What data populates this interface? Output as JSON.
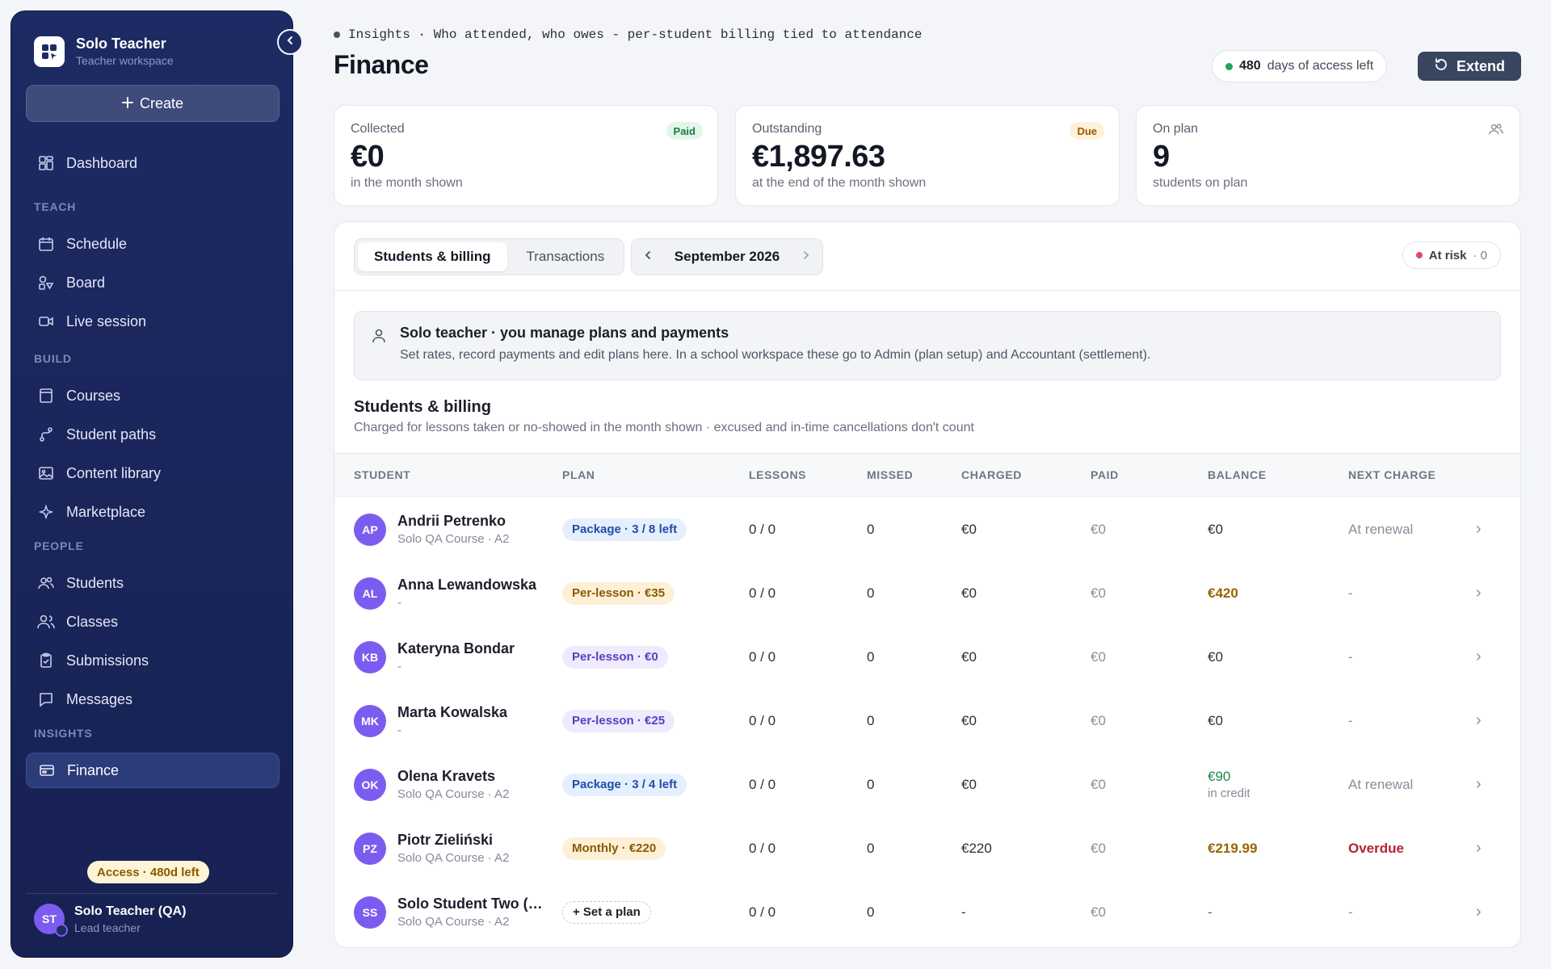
{
  "sidebar": {
    "brand_title": "Solo Teacher",
    "brand_sub": "Teacher workspace",
    "create_label": "Create",
    "dashboard": "Dashboard",
    "sections": {
      "teach": "TEACH",
      "build": "BUILD",
      "people": "PEOPLE",
      "insights": "INSIGHTS"
    },
    "items": {
      "schedule": "Schedule",
      "board": "Board",
      "live": "Live session",
      "courses": "Courses",
      "paths": "Student paths",
      "library": "Content library",
      "marketplace": "Marketplace",
      "students": "Students",
      "classes": "Classes",
      "submissions": "Submissions",
      "messages": "Messages",
      "finance": "Finance"
    },
    "access_pill": "Access · 480d left",
    "user_initials": "ST",
    "user_name": "Solo Teacher (QA)",
    "user_role": "Lead teacher"
  },
  "header": {
    "crumb": "Insights · Who attended, who owes - per-student billing tied to attendance",
    "title": "Finance",
    "days_count": "480",
    "days_label": "days of access left",
    "extend_label": "Extend"
  },
  "stats": {
    "collected": {
      "label": "Collected",
      "value": "€0",
      "note": "in the month shown",
      "badge": "Paid"
    },
    "outstanding": {
      "label": "Outstanding",
      "value": "€1,897.63",
      "note": "at the end of the month shown",
      "badge": "Due"
    },
    "on_plan": {
      "label": "On plan",
      "value": "9",
      "note": "students on plan"
    }
  },
  "panel": {
    "tab_students": "Students & billing",
    "tab_transactions": "Transactions",
    "month": "September 2026",
    "risk_label": "At risk",
    "risk_count": "· 0",
    "info_title": "Solo teacher · you manage plans and payments",
    "info_text": "Set rates, record payments and edit plans here. In a school workspace these go to Admin (plan setup) and Accountant (settlement).",
    "section_title": "Students & billing",
    "section_sub": "Charged for lessons taken or no-showed in the month shown · excused and in-time cancellations don't count"
  },
  "table": {
    "headers": [
      "STUDENT",
      "PLAN",
      "LESSONS",
      "MISSED",
      "CHARGED",
      "PAID",
      "BALANCE",
      "NEXT CHARGE"
    ],
    "rows": [
      {
        "initials": "AP",
        "name": "Andrii Petrenko",
        "course": "Solo QA Course · A2",
        "plan": "Package · 3 / 8 left",
        "lessons": "0 / 0",
        "missed": "0",
        "charged": "€0",
        "paid": "€0",
        "balance": "€0",
        "balance_note": "",
        "next": "At renewal"
      },
      {
        "initials": "AL",
        "name": "Anna Lewandowska",
        "course": "-",
        "plan": "Per-lesson · €35",
        "lessons": "0 / 0",
        "missed": "0",
        "charged": "€0",
        "paid": "€0",
        "balance": "€420",
        "balance_note": "",
        "next": "-"
      },
      {
        "initials": "KB",
        "name": "Kateryna Bondar",
        "course": "-",
        "plan": "Per-lesson · €0",
        "lessons": "0 / 0",
        "missed": "0",
        "charged": "€0",
        "paid": "€0",
        "balance": "€0",
        "balance_note": "",
        "next": "-"
      },
      {
        "initials": "MK",
        "name": "Marta Kowalska",
        "course": "-",
        "plan": "Per-lesson · €25",
        "lessons": "0 / 0",
        "missed": "0",
        "charged": "€0",
        "paid": "€0",
        "balance": "€0",
        "balance_note": "",
        "next": "-"
      },
      {
        "initials": "OK",
        "name": "Olena Kravets",
        "course": "Solo QA Course · A2",
        "plan": "Package · 3 / 4 left",
        "lessons": "0 / 0",
        "missed": "0",
        "charged": "€0",
        "paid": "€0",
        "balance": "€90",
        "balance_note": "in credit",
        "next": "At renewal"
      },
      {
        "initials": "PZ",
        "name": "Piotr Zieliński",
        "course": "Solo QA Course · A2",
        "plan": "Monthly · €220",
        "lessons": "0 / 0",
        "missed": "0",
        "charged": "€220",
        "paid": "€0",
        "balance": "€219.99",
        "balance_note": "",
        "next": "Overdue"
      },
      {
        "initials": "SS",
        "name": "Solo Student Two (QA)",
        "course": "Solo QA Course · A2",
        "plan": "+ Set a plan",
        "lessons": "0 / 0",
        "missed": "0",
        "charged": "-",
        "paid": "€0",
        "balance": "-",
        "balance_note": "",
        "next": "-"
      }
    ]
  },
  "colors": {
    "sidebar": "#1d2a63",
    "avatar": "#7c5cf0",
    "accent_active": "#2c3b7a"
  }
}
